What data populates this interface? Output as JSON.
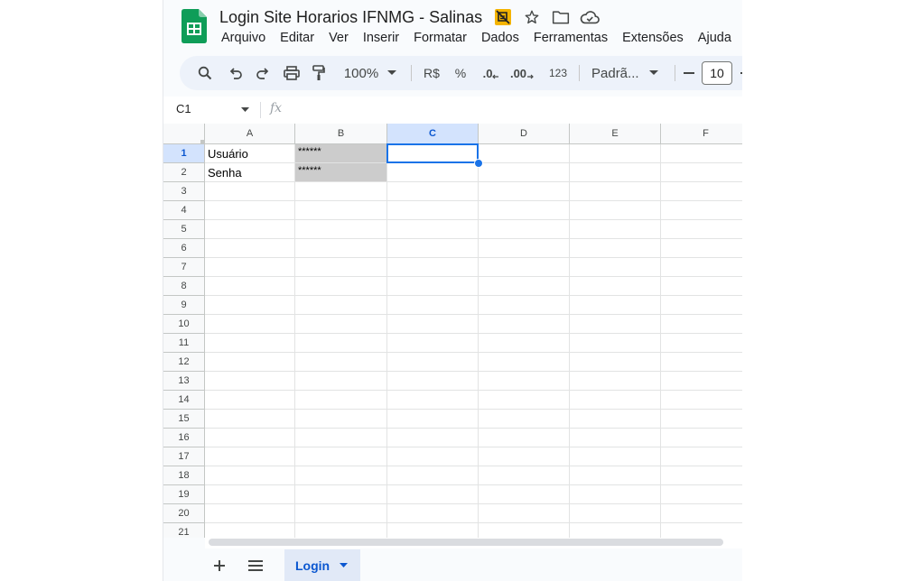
{
  "document": {
    "title": "Login Site Horarios IFNMG - Salinas"
  },
  "title_icons": [
    "no-sync-icon",
    "star-icon",
    "folder-icon",
    "cloud-done-icon"
  ],
  "menu": [
    "Arquivo",
    "Editar",
    "Ver",
    "Inserir",
    "Formatar",
    "Dados",
    "Ferramentas",
    "Extensões",
    "Ajuda"
  ],
  "toolbar": {
    "zoom": "100%",
    "currency": "R$",
    "percent": "%",
    "decimal_decrease": ".0",
    "decimal_increase": ".00",
    "more_formats": "123",
    "font": "Padrã...",
    "font_size": "10",
    "minus": "—",
    "plus": "+"
  },
  "formula_bar": {
    "cell_ref": "C1",
    "fx": "fx",
    "value": ""
  },
  "grid": {
    "columns": [
      "A",
      "B",
      "C",
      "D",
      "E",
      "F"
    ],
    "rows": [
      "1",
      "2",
      "3",
      "4",
      "5",
      "6",
      "7",
      "8",
      "9",
      "10",
      "11",
      "12",
      "13",
      "14",
      "15",
      "16",
      "17",
      "18",
      "19",
      "20",
      "21"
    ],
    "selected_cell": "C1",
    "cells": {
      "A1": "Usuário",
      "A2": "Senha",
      "B1": "******",
      "B2": "******"
    }
  },
  "sheet_tabs": [
    {
      "label": "Login",
      "active": true
    }
  ],
  "colors": {
    "accent": "#1a73e8",
    "selected_header": "#d3e3fd",
    "masked_cell": "#cccccc",
    "sheets_green": "#0f9d58"
  }
}
